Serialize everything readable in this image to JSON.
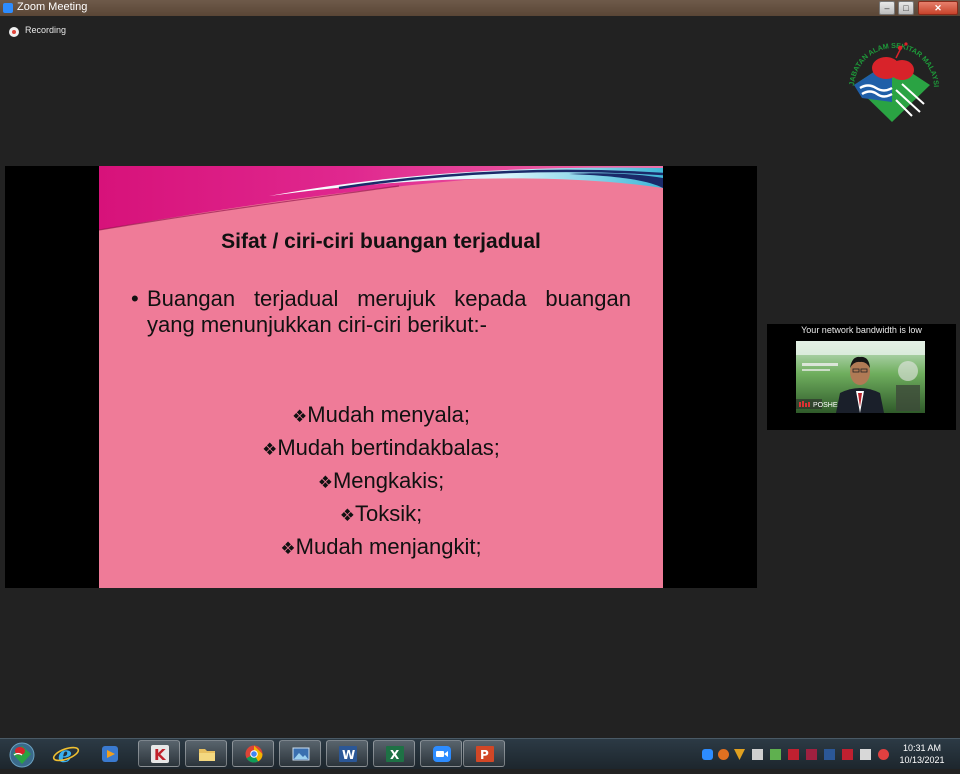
{
  "window": {
    "title": "Zoom Meeting",
    "recording_label": "Recording",
    "controls": {
      "minimize": "–",
      "maximize": "□",
      "close": "✕"
    }
  },
  "logo": {
    "text": "JABATAN ALAM SEKITAR MALAYSIA",
    "colors": {
      "text": "#1e9a3a",
      "red": "#d8232a",
      "blue": "#1f5fa8",
      "green": "#2aa343"
    }
  },
  "slide": {
    "title": "Sifat / ciri-ciri buangan terjadual",
    "bullet_marker": "•",
    "bullet": "Buangan terjadual merujuk kepada buangan yang menunjukkan ciri-ciri berikut:-",
    "item_marker": "❖",
    "items": [
      "Mudah menyala;",
      "Mudah bertindakbalas;",
      "Mengkakis;",
      "Toksik;",
      "Mudah menjangkit;"
    ],
    "colors": {
      "background": "#ef7b98"
    }
  },
  "video_panel": {
    "notice": "Your network bandwidth is low",
    "participant_label": "POSHE"
  },
  "taskbar": {
    "items": [
      {
        "icon": "ie-icon"
      },
      {
        "icon": "media-player-icon"
      },
      {
        "icon": "kaspersky-icon"
      },
      {
        "icon": "file-explorer-icon"
      },
      {
        "icon": "chrome-icon"
      },
      {
        "icon": "photo-viewer-icon"
      },
      {
        "icon": "word-icon",
        "glyph": "W"
      },
      {
        "icon": "excel-icon",
        "glyph": "X"
      },
      {
        "icon": "zoom-icon"
      },
      {
        "icon": "powerpoint-icon",
        "glyph": "P"
      }
    ],
    "clock": {
      "time": "10:31 AM",
      "date": "10/13/2021"
    }
  }
}
